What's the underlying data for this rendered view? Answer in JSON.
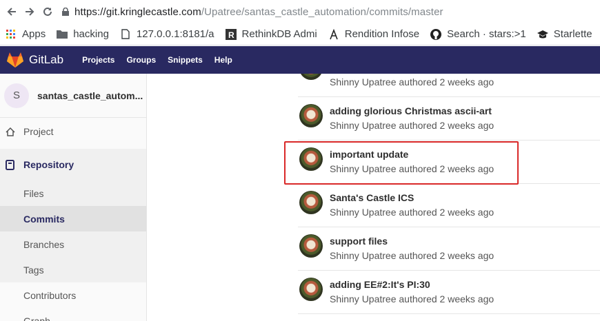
{
  "browser": {
    "url_host": "https://git.kringlecastle.com",
    "url_path": "/Upatree/santas_castle_automation/commits/master",
    "bookmarks": [
      {
        "label": "Apps",
        "icon": "apps-grid-icon"
      },
      {
        "label": "hacking",
        "icon": "folder-icon"
      },
      {
        "label": "127.0.0.1:8181/a",
        "icon": "page-icon"
      },
      {
        "label": "RethinkDB Admi",
        "icon": "rethinkdb-icon"
      },
      {
        "label": "Rendition Infose",
        "icon": "rendition-icon"
      },
      {
        "label": "Search · stars:>1",
        "icon": "github-icon"
      },
      {
        "label": "Starlette",
        "icon": "graduation-cap-icon"
      }
    ]
  },
  "header": {
    "brand": "GitLab",
    "nav": [
      "Projects",
      "Groups",
      "Snippets",
      "Help"
    ],
    "colors": {
      "bar": "#292961",
      "logo": "#e24329"
    }
  },
  "sidebar": {
    "project_initial": "S",
    "project_name": "santas_castle_autom...",
    "project_label": "Project",
    "repository_label": "Repository",
    "items": [
      "Files",
      "Commits",
      "Branches",
      "Tags",
      "Contributors"
    ],
    "active_item": "Commits",
    "graph_label": "Graph"
  },
  "commits": [
    {
      "title": "",
      "meta": "Shinny Upatree authored 2 weeks ago"
    },
    {
      "title": "adding glorious Christmas ascii-art",
      "meta": "Shinny Upatree authored 2 weeks ago"
    },
    {
      "title": "important update",
      "meta": "Shinny Upatree authored 2 weeks ago",
      "highlighted": true
    },
    {
      "title": "Santa's Castle ICS",
      "meta": "Shinny Upatree authored 2 weeks ago"
    },
    {
      "title": "support files",
      "meta": "Shinny Upatree authored 2 weeks ago"
    },
    {
      "title": "adding EE#2:It's PI:30",
      "meta": "Shinny Upatree authored 2 weeks ago"
    }
  ],
  "highlight_color": "#d92828"
}
